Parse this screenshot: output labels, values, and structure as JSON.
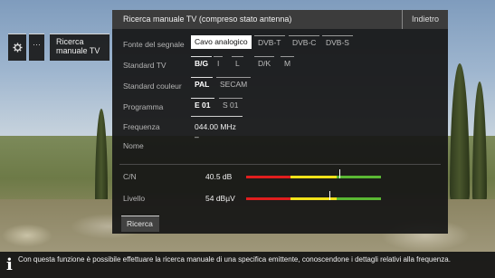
{
  "side_menu": {
    "dots_label": "···",
    "current_item": "Ricerca manuale TV"
  },
  "panel": {
    "title": "Ricerca manuale TV (compreso stato antenna)",
    "back_label": "Indietro",
    "signal_source": {
      "label": "Fonte del segnale",
      "options": [
        "Cavo analogico",
        "DVB-T",
        "DVB-C",
        "DVB-S"
      ],
      "selected": "Cavo analogico"
    },
    "tv_standard": {
      "label": "Standard TV",
      "options": [
        "B/G",
        "I",
        "L",
        "D/K",
        "M"
      ],
      "selected": "B/G"
    },
    "color_standard": {
      "label": "Standard couleur",
      "options": [
        "PAL",
        "SECAM"
      ],
      "selected": "PAL"
    },
    "program": {
      "label": "Programma",
      "options": [
        "E 01",
        "S 01"
      ],
      "selected": "E 01"
    },
    "frequency": {
      "label": "Frequenza",
      "value": "044.00 MHz"
    },
    "name": {
      "label": "Nome",
      "value": "–"
    },
    "cn": {
      "label": "C/N",
      "value": "40.5 dB",
      "level_fraction": 0.69
    },
    "level": {
      "label": "Livello",
      "value": "54 dBµV",
      "level_fraction": 0.62
    },
    "search_label": "Ricerca"
  },
  "info_bar": {
    "icon": "info-icon",
    "text": "Con questa funzione è possibile effettuare la ricerca manuale di una specifica emittente, conoscendone i dettagli relativi alla frequenza."
  },
  "colors": {
    "meter_red": "#e01e1e",
    "meter_yellow": "#f0e21a",
    "meter_green": "#5ab833",
    "panel_bg": "#161616"
  }
}
